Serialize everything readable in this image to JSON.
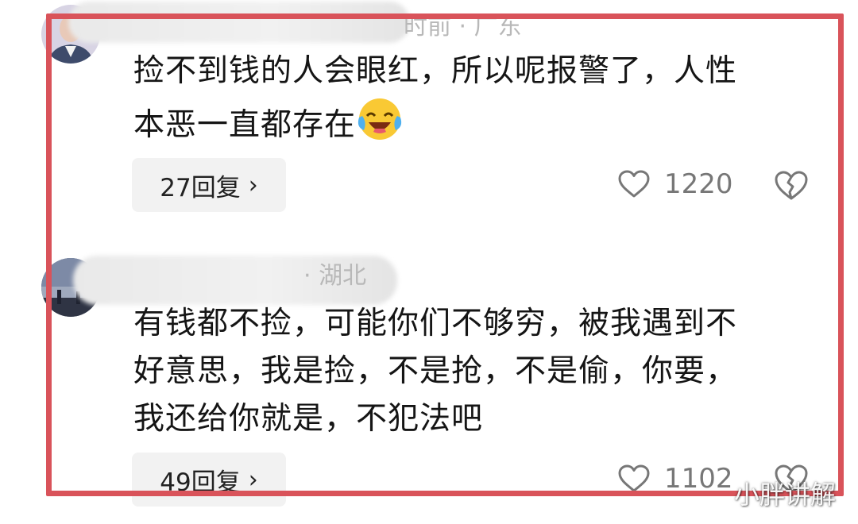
{
  "comments": [
    {
      "meta_visible": "时前 · 广东",
      "text_line1": "捡不到钱的人会眼红，所以呢报警了，人性",
      "text_line2": "本恶一直都存在",
      "emoji": "laughing-crying-emoji",
      "reply_label": "27回复",
      "like_count": "1220"
    },
    {
      "meta_visible": "· 湖北",
      "text_line1": "有钱都不捡，可能你们不够穷，被我遇到不",
      "text_line2": "好意思，我是捡，不是抢，不是偷，你要，",
      "text_line3": "我还给你就是，不犯法吧",
      "reply_label": "49回复",
      "like_count": "1102"
    }
  ],
  "watermark": "小胖讲解",
  "colors": {
    "frame": "#d9535a",
    "reply_bg": "#f2f2f2",
    "icon": "#777777"
  }
}
